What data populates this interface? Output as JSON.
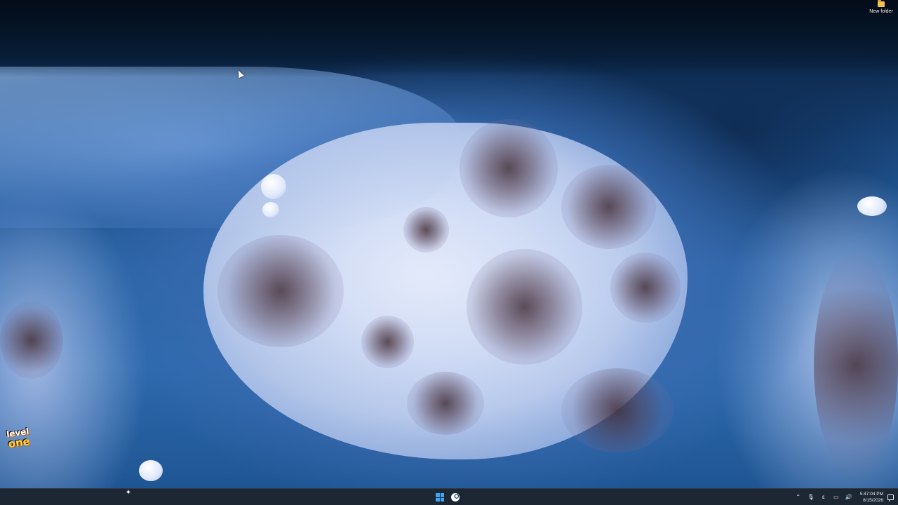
{
  "desktop": {
    "icons": [
      {
        "label": "New folder",
        "icon": "folder-icon"
      }
    ],
    "wallpaper": {
      "watermark_line1": "level",
      "watermark_line2": "one"
    }
  },
  "taskbar": {
    "left": {
      "copilot_icon": "sparkle-icon",
      "glyph": "✦"
    },
    "pinned": [
      {
        "name": "start",
        "icon": "windows-start-icon"
      },
      {
        "name": "steam",
        "icon": "steam-icon"
      }
    ],
    "tray": {
      "chevron_glyph": "⌃",
      "mic_glyph": "🎙",
      "language_glyph": "ε",
      "network_glyph": "▭",
      "volume_glyph": "🔊",
      "time": "5:47:04 PM",
      "date": "8/15/2026"
    }
  },
  "colors": {
    "taskbar_bg": "#1c2733",
    "start_accent": "#3ea3f5",
    "folder": "#f4c14b"
  }
}
